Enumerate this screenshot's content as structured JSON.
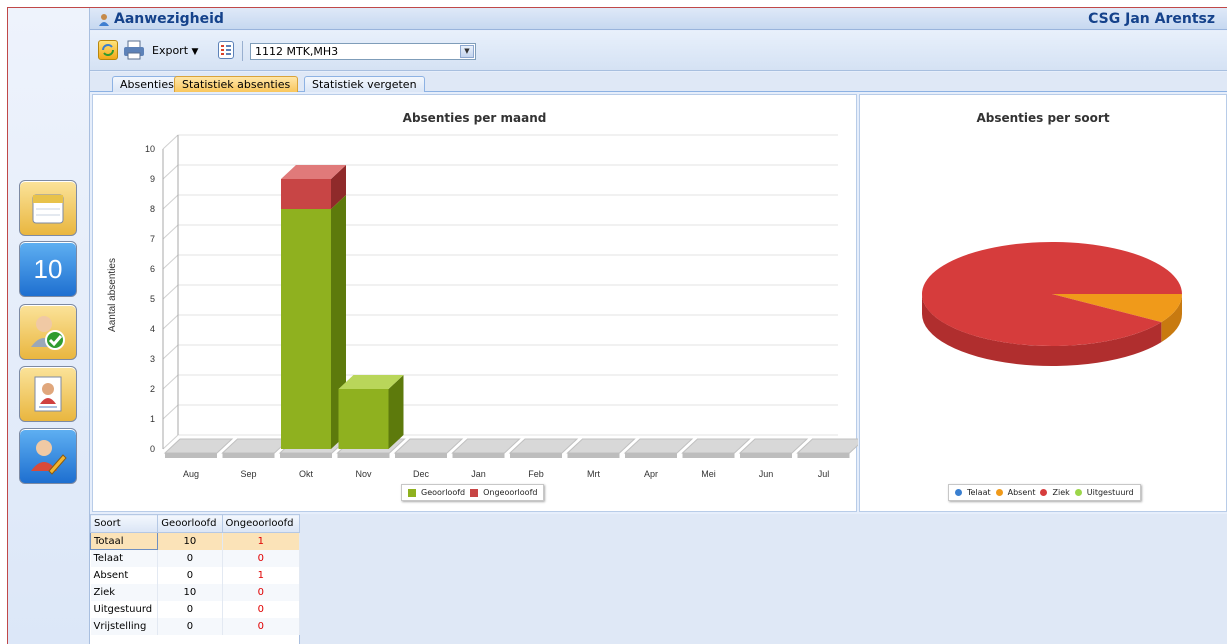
{
  "header": {
    "app_title": "Aanwezigheid",
    "school": "CSG Jan Arentsz"
  },
  "toolbar": {
    "export_label": "Export",
    "class_select_value": "1112 MTK,MH3",
    "icons": [
      "refresh-icon",
      "print-icon",
      "list-icon"
    ]
  },
  "tabs": [
    {
      "label": "Absenties",
      "active": false
    },
    {
      "label": "Statistiek absenties",
      "active": true
    },
    {
      "label": "Statistiek vergeten",
      "active": false
    }
  ],
  "left_nav": [
    "calendar-icon",
    "ten-icon",
    "user-check-icon",
    "portrait-icon",
    "user-edit-icon"
  ],
  "left_nav_ten_label": "10",
  "colors": {
    "accent": "#15428b",
    "geoorloofd": "#8fb11f",
    "ongeoorloofd": "#c84545",
    "telaat": "#3a7fd0",
    "absent": "#f09a1a",
    "ziek": "#d63c3c",
    "uitgestuurd": "#9cd64a"
  },
  "chart_data": [
    {
      "type": "bar",
      "stacked": true,
      "title": "Absenties per maand",
      "xlabel": "",
      "ylabel": "Aantal absenties",
      "ylim": [
        0,
        10
      ],
      "yticks": [
        "0",
        "1",
        "2",
        "3",
        "4",
        "5",
        "6",
        "7",
        "8",
        "9",
        "10"
      ],
      "categories": [
        "Aug",
        "Sep",
        "Okt",
        "Nov",
        "Dec",
        "Jan",
        "Feb",
        "Mrt",
        "Apr",
        "Mei",
        "Jun",
        "Jul"
      ],
      "series": [
        {
          "name": "Geoorloofd",
          "values": [
            0,
            0,
            8,
            2,
            0,
            0,
            0,
            0,
            0,
            0,
            0,
            0
          ]
        },
        {
          "name": "Ongeoorloofd",
          "values": [
            0,
            0,
            1,
            0,
            0,
            0,
            0,
            0,
            0,
            0,
            0,
            0
          ]
        }
      ],
      "legend": "bottom"
    },
    {
      "type": "pie",
      "title": "Absenties per soort",
      "labels": [
        "Telaat",
        "Absent",
        "Ziek",
        "Uitgestuurd"
      ],
      "values": [
        0,
        1,
        10,
        0
      ],
      "legend": "bottom"
    }
  ],
  "table": {
    "headers": [
      "Soort",
      "Geoorloofd",
      "Ongeoorloofd"
    ],
    "rows": [
      {
        "soort": "Totaal",
        "geoorloofd": "10",
        "ongeoorloofd": "1"
      },
      {
        "soort": "Telaat",
        "geoorloofd": "0",
        "ongeoorloofd": "0"
      },
      {
        "soort": "Absent",
        "geoorloofd": "0",
        "ongeoorloofd": "1"
      },
      {
        "soort": "Ziek",
        "geoorloofd": "10",
        "ongeoorloofd": "0"
      },
      {
        "soort": "Uitgestuurd",
        "geoorloofd": "0",
        "ongeoorloofd": "0"
      },
      {
        "soort": "Vrijstelling",
        "geoorloofd": "0",
        "ongeoorloofd": "0"
      }
    ]
  }
}
